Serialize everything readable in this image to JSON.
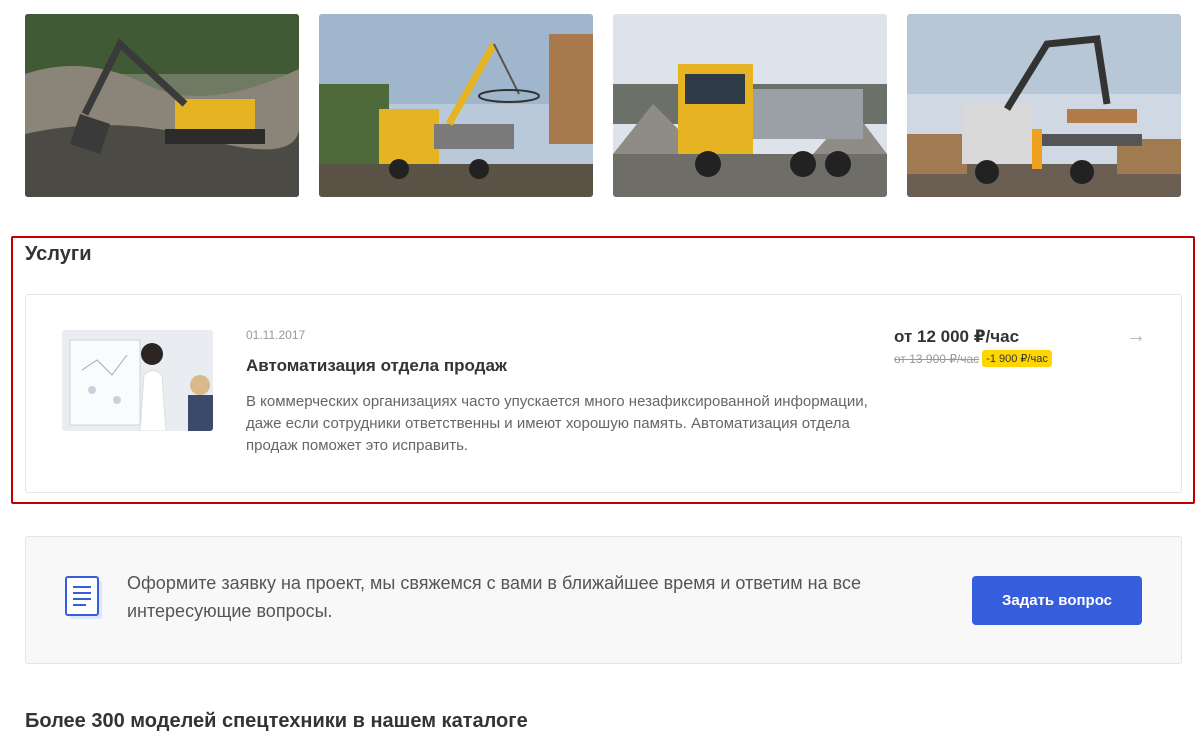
{
  "gallery": {
    "items": [
      {
        "icon": "excavator-photo"
      },
      {
        "icon": "crane-truck-photo"
      },
      {
        "icon": "dump-truck-photo"
      },
      {
        "icon": "timber-truck-photo"
      }
    ]
  },
  "services": {
    "title": "Услуги",
    "items": [
      {
        "date": "01.11.2017",
        "name": "Автоматизация отдела продаж",
        "description": "В коммерческих организациях часто упускается много незафиксированной информации, даже если сотрудники ответственны и имеют хорошую память. Автоматизация отдела продаж поможет это исправить.",
        "price": "от 12 000 ₽/час",
        "old_price": "от 13 900 ₽/час",
        "discount": "-1 900 ₽/час",
        "arrow": "→"
      }
    ]
  },
  "request": {
    "text": "Оформите заявку на проект, мы свяжемся с вами в ближайшее время и ответим на все интересующие вопросы.",
    "button_label": "Задать вопрос"
  },
  "catalog": {
    "title": "Более 300 моделей спецтехники в нашем каталоге"
  },
  "colors": {
    "accent": "#365edc",
    "discount_badge": "#ffd600",
    "highlight_frame": "#c00000"
  }
}
